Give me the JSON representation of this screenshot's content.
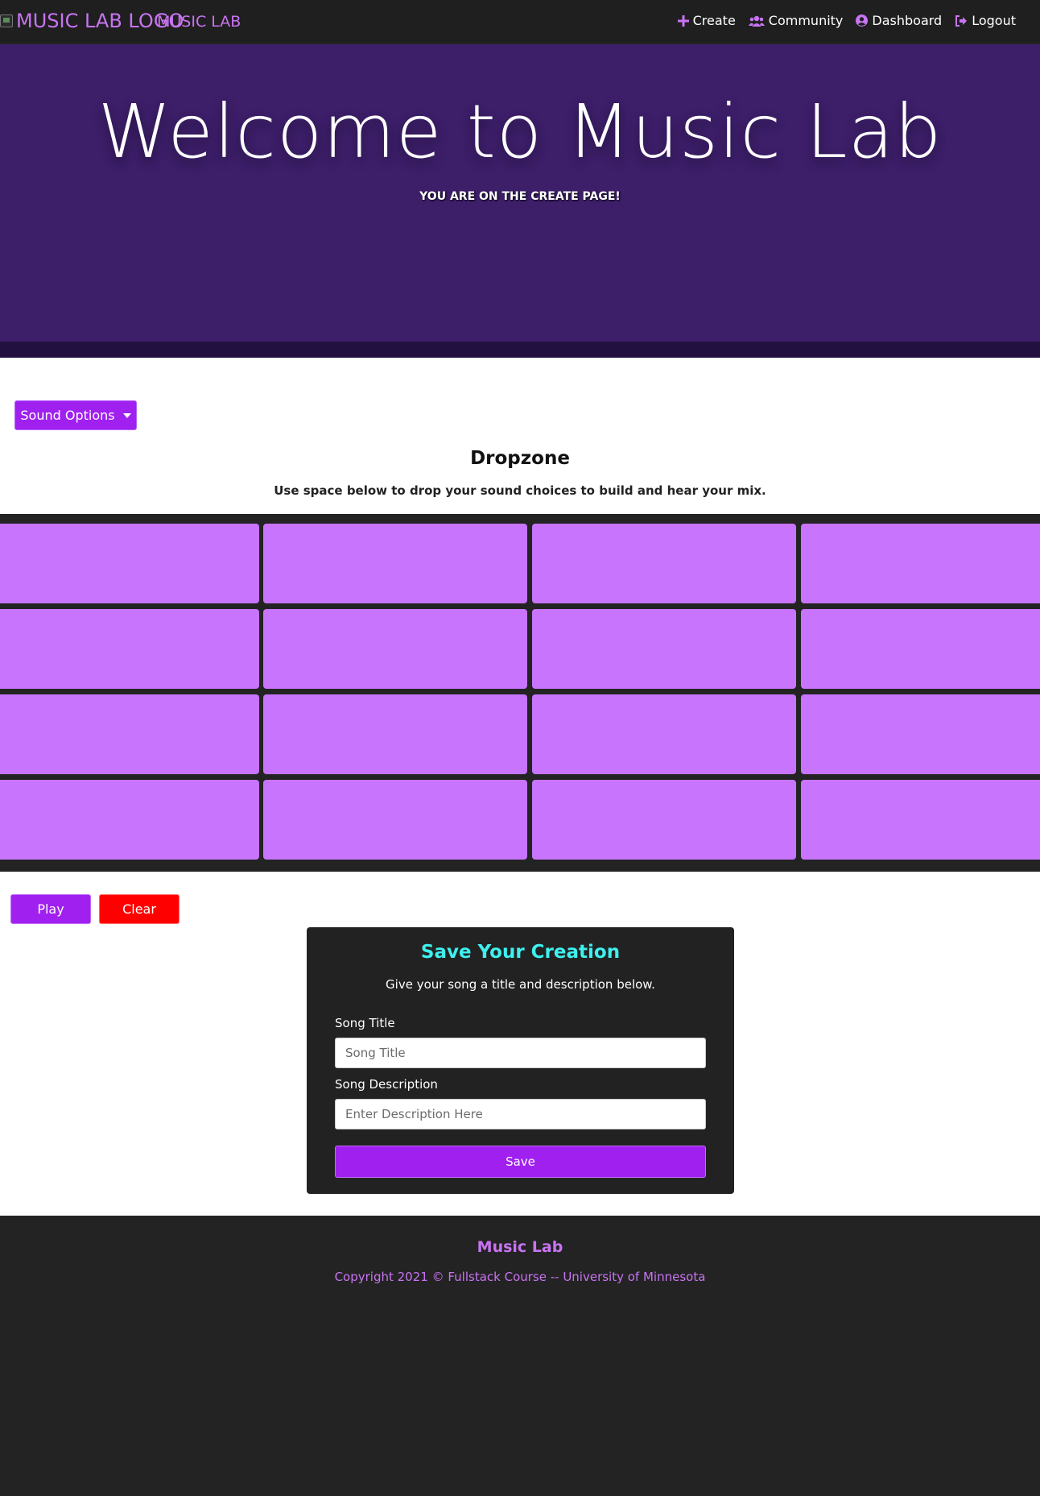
{
  "navbar": {
    "logo_alt": "MUSIC LAB LOGO",
    "brand": "MUSIC LAB",
    "links": [
      {
        "label": "Create",
        "icon": "plus-icon"
      },
      {
        "label": "Community",
        "icon": "users-icon"
      },
      {
        "label": "Dashboard",
        "icon": "user-circle-icon"
      },
      {
        "label": "Logout",
        "icon": "sign-out-icon"
      }
    ]
  },
  "hero": {
    "title": "Welcome to Music Lab",
    "subtitle": "YOU ARE ON THE CREATE PAGE!"
  },
  "sound_options": {
    "label": "Sound Options"
  },
  "dropzone": {
    "title": "Dropzone",
    "subtitle": "Use space below to drop your sound choices to build and hear your mix.",
    "rows": 4,
    "columns": 4
  },
  "controls": {
    "play_label": "Play",
    "clear_label": "Clear"
  },
  "save_form": {
    "title": "Save Your Creation",
    "subtitle": "Give your song a title and description below.",
    "title_label": "Song Title",
    "title_placeholder": "Song Title",
    "title_value": "",
    "description_label": "Song Description",
    "description_placeholder": "Enter Description Here",
    "description_value": "",
    "save_label": "Save"
  },
  "footer": {
    "title": "Music Lab",
    "copyright": "Copyright 2021 © Fullstack Course -- University of Minnesota"
  },
  "colors": {
    "accent": "#a020f0",
    "brand_purple": "#c874f2",
    "hero_bg": "#3c1e69",
    "cell": "#c874fd",
    "danger": "#ff0000",
    "save_title": "#3ef0ef",
    "dark": "#232323"
  }
}
